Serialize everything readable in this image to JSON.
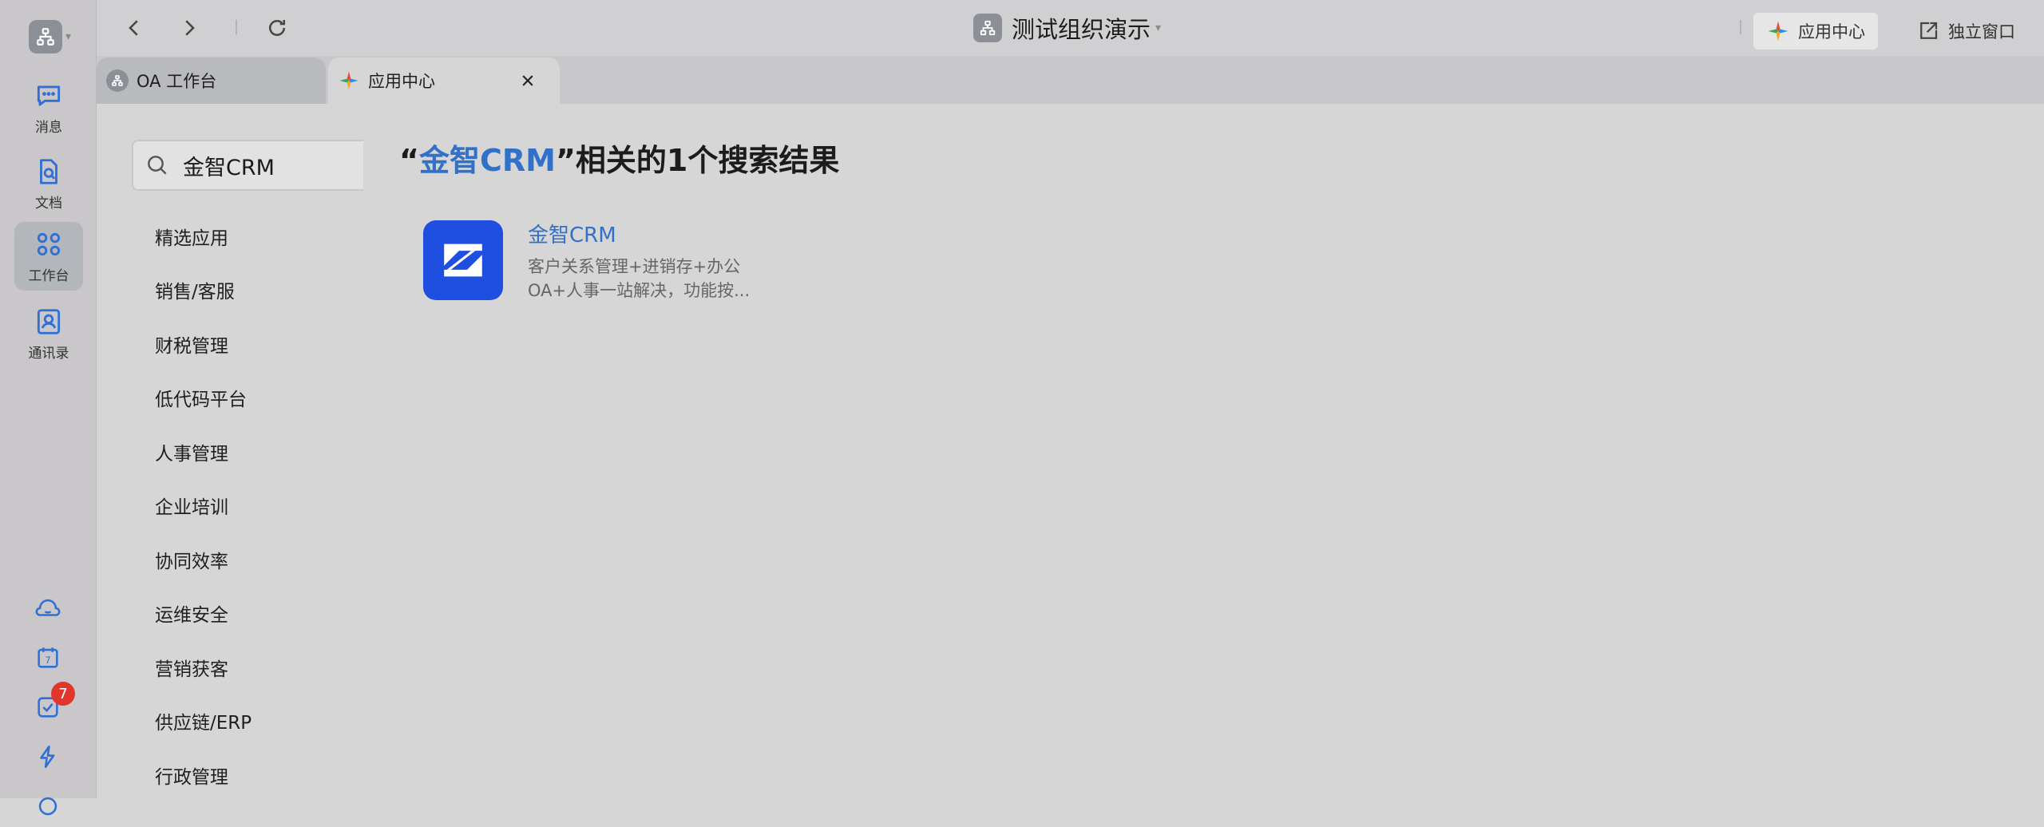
{
  "topbar": {
    "org_title": "测试组织演示",
    "app_center_label": "应用中心",
    "standalone_window_label": "独立窗口"
  },
  "rail": {
    "items": [
      {
        "label": "消息"
      },
      {
        "label": "文档"
      },
      {
        "label": "工作台"
      },
      {
        "label": "通讯录"
      }
    ],
    "todo_badge": "7"
  },
  "tabs": [
    {
      "label": "OA 工作台"
    },
    {
      "label": "应用中心"
    }
  ],
  "search": {
    "value": "金智CRM"
  },
  "categories": [
    "精选应用",
    "销售/客服",
    "财税管理",
    "低代码平台",
    "人事管理",
    "企业培训",
    "协同效率",
    "运维安全",
    "营销获客",
    "供应链/ERP",
    "行政管理"
  ],
  "results": {
    "quote_open": "“",
    "query": "金智CRM",
    "suffix": "”相关的1个搜索结果",
    "apps": [
      {
        "name": "金智CRM",
        "description": "客户关系管理+进销存+办公OA+人事一站解决，功能按..."
      }
    ]
  },
  "colors": {
    "accent": "#3271c9",
    "badge": "#e0362c",
    "app_logo": "#1f4fe0"
  }
}
